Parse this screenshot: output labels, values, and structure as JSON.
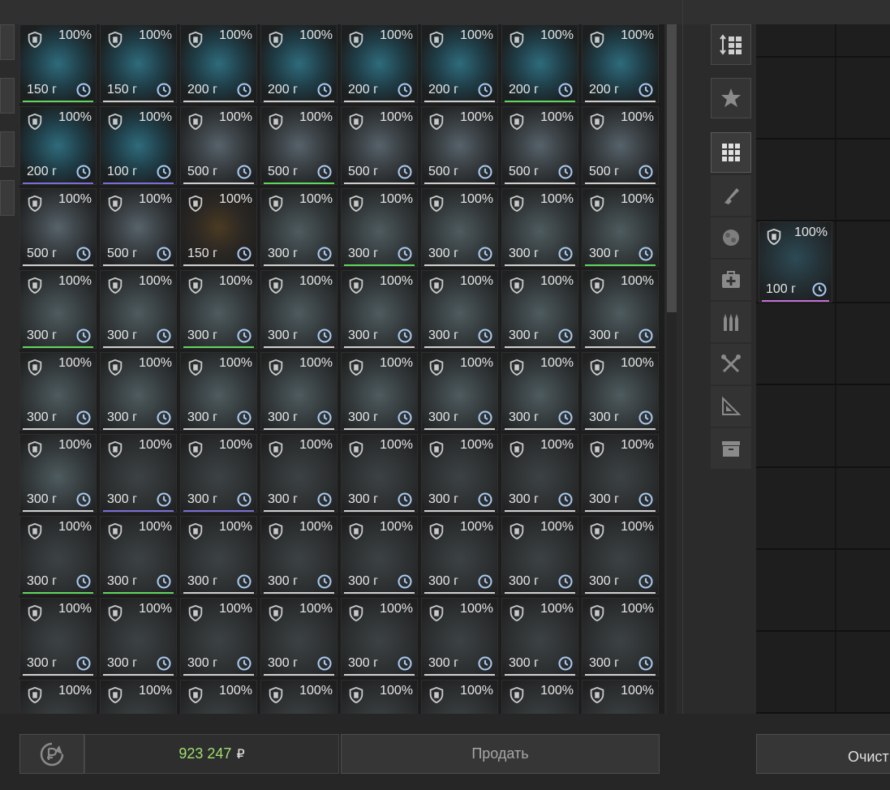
{
  "inventory": {
    "items": [
      {
        "pct": "100%",
        "weight": "150 г",
        "kind": "teal",
        "bar": "green"
      },
      {
        "pct": "100%",
        "weight": "150 г",
        "kind": "teal",
        "bar": "white"
      },
      {
        "pct": "100%",
        "weight": "200 г",
        "kind": "teal",
        "bar": "white"
      },
      {
        "pct": "100%",
        "weight": "200 г",
        "kind": "teal",
        "bar": "white"
      },
      {
        "pct": "100%",
        "weight": "200 г",
        "kind": "teal",
        "bar": "white"
      },
      {
        "pct": "100%",
        "weight": "200 г",
        "kind": "teal",
        "bar": "white"
      },
      {
        "pct": "100%",
        "weight": "200 г",
        "kind": "teal",
        "bar": "green"
      },
      {
        "pct": "100%",
        "weight": "200 г",
        "kind": "teal",
        "bar": "white"
      },
      {
        "pct": "100%",
        "weight": "200 г",
        "kind": "teal",
        "bar": "purple"
      },
      {
        "pct": "100%",
        "weight": "100 г",
        "kind": "teal",
        "bar": "purple"
      },
      {
        "pct": "100%",
        "weight": "500 г",
        "kind": "gray",
        "bar": "white"
      },
      {
        "pct": "100%",
        "weight": "500 г",
        "kind": "gray",
        "bar": "green"
      },
      {
        "pct": "100%",
        "weight": "500 г",
        "kind": "gray",
        "bar": "white"
      },
      {
        "pct": "100%",
        "weight": "500 г",
        "kind": "gray",
        "bar": "white"
      },
      {
        "pct": "100%",
        "weight": "500 г",
        "kind": "gray",
        "bar": "white"
      },
      {
        "pct": "100%",
        "weight": "500 г",
        "kind": "gray",
        "bar": "white"
      },
      {
        "pct": "100%",
        "weight": "500 г",
        "kind": "gray",
        "bar": "white"
      },
      {
        "pct": "100%",
        "weight": "500 г",
        "kind": "gray",
        "bar": "white"
      },
      {
        "pct": "100%",
        "weight": "150 г",
        "kind": "yellow",
        "bar": "white"
      },
      {
        "pct": "100%",
        "weight": "300 г",
        "kind": "peacock",
        "bar": "white"
      },
      {
        "pct": "100%",
        "weight": "300 г",
        "kind": "peacock",
        "bar": "green"
      },
      {
        "pct": "100%",
        "weight": "300 г",
        "kind": "peacock",
        "bar": "white"
      },
      {
        "pct": "100%",
        "weight": "300 г",
        "kind": "peacock",
        "bar": "white"
      },
      {
        "pct": "100%",
        "weight": "300 г",
        "kind": "peacock",
        "bar": "green"
      },
      {
        "pct": "100%",
        "weight": "300 г",
        "kind": "peacock",
        "bar": "green"
      },
      {
        "pct": "100%",
        "weight": "300 г",
        "kind": "peacock",
        "bar": "white"
      },
      {
        "pct": "100%",
        "weight": "300 г",
        "kind": "peacock",
        "bar": "green"
      },
      {
        "pct": "100%",
        "weight": "300 г",
        "kind": "peacock",
        "bar": "white"
      },
      {
        "pct": "100%",
        "weight": "300 г",
        "kind": "peacock",
        "bar": "white"
      },
      {
        "pct": "100%",
        "weight": "300 г",
        "kind": "peacock",
        "bar": "white"
      },
      {
        "pct": "100%",
        "weight": "300 г",
        "kind": "peacock",
        "bar": "white"
      },
      {
        "pct": "100%",
        "weight": "300 г",
        "kind": "peacock",
        "bar": "white"
      },
      {
        "pct": "100%",
        "weight": "300 г",
        "kind": "peacock",
        "bar": "white"
      },
      {
        "pct": "100%",
        "weight": "300 г",
        "kind": "peacock",
        "bar": "white"
      },
      {
        "pct": "100%",
        "weight": "300 г",
        "kind": "peacock",
        "bar": "white"
      },
      {
        "pct": "100%",
        "weight": "300 г",
        "kind": "peacock",
        "bar": "white"
      },
      {
        "pct": "100%",
        "weight": "300 г",
        "kind": "peacock",
        "bar": "white"
      },
      {
        "pct": "100%",
        "weight": "300 г",
        "kind": "peacock",
        "bar": "white"
      },
      {
        "pct": "100%",
        "weight": "300 г",
        "kind": "peacock",
        "bar": "white"
      },
      {
        "pct": "100%",
        "weight": "300 г",
        "kind": "peacock",
        "bar": "white"
      },
      {
        "pct": "100%",
        "weight": "300 г",
        "kind": "peacock",
        "bar": "white"
      },
      {
        "pct": "100%",
        "weight": "300 г",
        "kind": "rough",
        "bar": "purple"
      },
      {
        "pct": "100%",
        "weight": "300 г",
        "kind": "rough",
        "bar": "purple"
      },
      {
        "pct": "100%",
        "weight": "300 г",
        "kind": "rough",
        "bar": "white"
      },
      {
        "pct": "100%",
        "weight": "300 г",
        "kind": "rough",
        "bar": "white"
      },
      {
        "pct": "100%",
        "weight": "300 г",
        "kind": "rough",
        "bar": "white"
      },
      {
        "pct": "100%",
        "weight": "300 г",
        "kind": "rough",
        "bar": "white"
      },
      {
        "pct": "100%",
        "weight": "300 г",
        "kind": "rough",
        "bar": "white"
      },
      {
        "pct": "100%",
        "weight": "300 г",
        "kind": "rough",
        "bar": "green"
      },
      {
        "pct": "100%",
        "weight": "300 г",
        "kind": "rough",
        "bar": "green"
      },
      {
        "pct": "100%",
        "weight": "300 г",
        "kind": "rough",
        "bar": "white"
      },
      {
        "pct": "100%",
        "weight": "300 г",
        "kind": "rough",
        "bar": "white"
      },
      {
        "pct": "100%",
        "weight": "300 г",
        "kind": "rough",
        "bar": "white"
      },
      {
        "pct": "100%",
        "weight": "300 г",
        "kind": "rough",
        "bar": "white"
      },
      {
        "pct": "100%",
        "weight": "300 г",
        "kind": "rough",
        "bar": "white"
      },
      {
        "pct": "100%",
        "weight": "300 г",
        "kind": "rough",
        "bar": "white"
      },
      {
        "pct": "100%",
        "weight": "300 г",
        "kind": "rough",
        "bar": "white"
      },
      {
        "pct": "100%",
        "weight": "300 г",
        "kind": "rough",
        "bar": "white"
      },
      {
        "pct": "100%",
        "weight": "300 г",
        "kind": "rough",
        "bar": "white"
      },
      {
        "pct": "100%",
        "weight": "300 г",
        "kind": "rough",
        "bar": "white"
      },
      {
        "pct": "100%",
        "weight": "300 г",
        "kind": "rough",
        "bar": "white"
      },
      {
        "pct": "100%",
        "weight": "300 г",
        "kind": "rough",
        "bar": "white"
      },
      {
        "pct": "100%",
        "weight": "300 г",
        "kind": "rough",
        "bar": "white"
      },
      {
        "pct": "100%",
        "weight": "300 г",
        "kind": "rough",
        "bar": "white"
      },
      {
        "pct": "100%",
        "weight": "",
        "kind": "rough",
        "bar": "none"
      },
      {
        "pct": "100%",
        "weight": "",
        "kind": "rough",
        "bar": "none"
      },
      {
        "pct": "100%",
        "weight": "",
        "kind": "rough",
        "bar": "none"
      },
      {
        "pct": "100%",
        "weight": "",
        "kind": "rough",
        "bar": "none"
      },
      {
        "pct": "100%",
        "weight": "",
        "kind": "rough",
        "bar": "none"
      },
      {
        "pct": "100%",
        "weight": "",
        "kind": "rough",
        "bar": "none"
      },
      {
        "pct": "100%",
        "weight": "",
        "kind": "rough",
        "bar": "none"
      },
      {
        "pct": "100%",
        "weight": "",
        "kind": "rough",
        "bar": "none"
      }
    ]
  },
  "categories": [
    {
      "icon": "sort-icon"
    },
    {
      "icon": "star-emblem-icon"
    },
    {
      "icon": "grid-icon",
      "active": true
    },
    {
      "icon": "weapon-icon"
    },
    {
      "icon": "artifact-icon"
    },
    {
      "icon": "medkit-icon"
    },
    {
      "icon": "ammo-icon"
    },
    {
      "icon": "tools-icon"
    },
    {
      "icon": "blueprint-icon"
    },
    {
      "icon": "storage-box-icon"
    }
  ],
  "sell_panel": {
    "item": {
      "pct": "100%",
      "weight": "100 г"
    }
  },
  "footer": {
    "balance": "923 247",
    "currency": "₽",
    "sell_label": "Продать",
    "clear_label": "Очист"
  },
  "colors": {
    "balance": "#9fe06f",
    "bar_green": "#5fd65f",
    "bar_purple": "#7a6fd6",
    "bar_white": "#cfcfcf",
    "sell_item_bar": "#c26fd6"
  }
}
